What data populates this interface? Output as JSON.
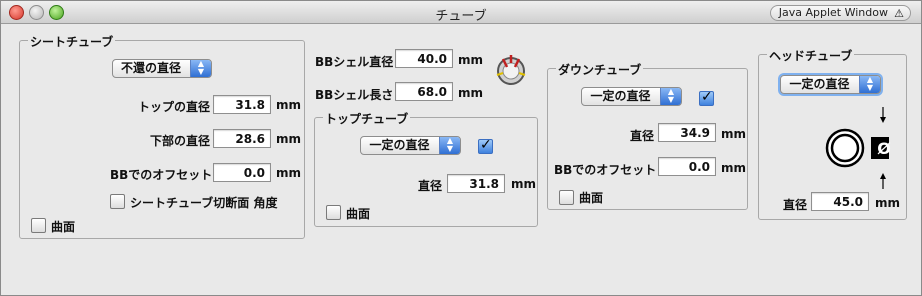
{
  "window": {
    "title": "チューブ",
    "applet_badge": "Java Applet Window"
  },
  "seat_tube": {
    "title": "シートチューブ",
    "type_select": "不還の直径",
    "top_diameter_label": "トップの直径",
    "top_diameter_value": "31.8",
    "bottom_diameter_label": "下部の直径",
    "bottom_diameter_value": "28.6",
    "bb_offset_label": "BBでのオフセット",
    "bb_offset_value": "0.0",
    "unit": "mm",
    "cut_angle_label": "シートチューブ切断面 角度",
    "curved_label": "曲面"
  },
  "bb_shell": {
    "diameter_label": "BBシェル直径",
    "diameter_value": "40.0",
    "length_label": "BBシェル長さ",
    "length_value": "68.0",
    "unit": "mm"
  },
  "top_tube": {
    "title": "トップチューブ",
    "type_select": "一定の直径",
    "diameter_label": "直径",
    "diameter_value": "31.8",
    "unit": "mm",
    "curved_label": "曲面"
  },
  "down_tube": {
    "title": "ダウンチューブ",
    "type_select": "一定の直径",
    "diameter_label": "直径",
    "diameter_value": "34.9",
    "bb_offset_label": "BBでのオフセット",
    "bb_offset_value": "0.0",
    "unit": "mm",
    "curved_label": "曲面"
  },
  "head_tube": {
    "title": "ヘッドチューブ",
    "type_select": "一定の直径",
    "diameter_label": "直径",
    "diameter_value": "45.0",
    "unit": "mm",
    "diameter_symbol": "Ø"
  }
}
